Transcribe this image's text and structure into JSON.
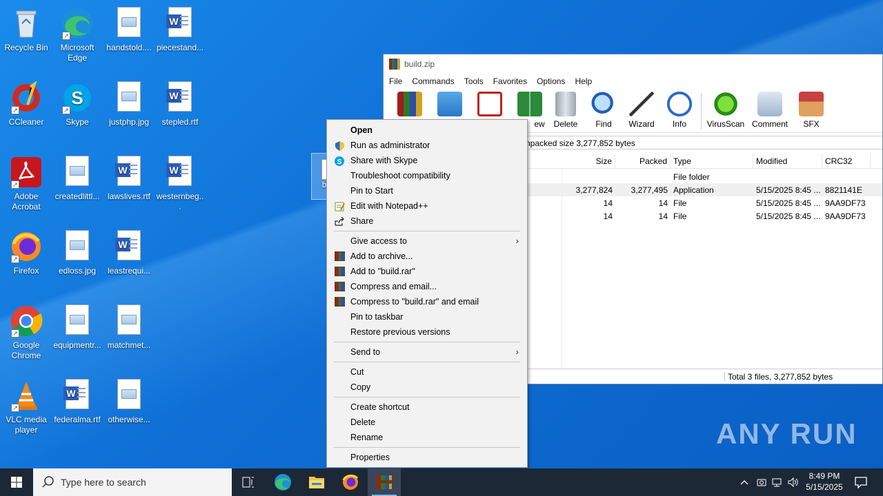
{
  "desktop": {
    "icons": [
      {
        "label": "Recycle Bin"
      },
      {
        "label": "Microsoft Edge"
      },
      {
        "label": "handstold...."
      },
      {
        "label": "piecestand..."
      },
      {
        "label": "CCleaner"
      },
      {
        "label": "Skype"
      },
      {
        "label": "justphp.jpg"
      },
      {
        "label": "stepled.rtf"
      },
      {
        "label": "Adobe Acrobat"
      },
      {
        "label": "createdlittl..."
      },
      {
        "label": "lawslives.rtf"
      },
      {
        "label": "westernbeg..."
      },
      {
        "label": "Firefox"
      },
      {
        "label": "edloss.jpg"
      },
      {
        "label": "leastrequi..."
      },
      {
        "label": "Google Chrome"
      },
      {
        "label": "equipmentr..."
      },
      {
        "label": "matchmet..."
      },
      {
        "label": "VLC media player"
      },
      {
        "label": "federalma.rtf"
      },
      {
        "label": "otherwise..."
      }
    ],
    "partial_icon_label": "bu",
    "watermark": "ANY RUN"
  },
  "winrar": {
    "title": "build.zip",
    "menu": [
      "File",
      "Commands",
      "Tools",
      "Favorites",
      "Options",
      "Help"
    ],
    "toolbar": [
      "ew",
      "Delete",
      "Find",
      "Wizard",
      "Info",
      "VirusScan",
      "Comment",
      "SFX"
    ],
    "address": "npacked size 3,277,852 bytes",
    "columns": [
      "Size",
      "Packed",
      "Type",
      "Modified",
      "CRC32"
    ],
    "rows": [
      {
        "size": "",
        "packed": "",
        "type": "File folder",
        "modified": "",
        "crc": ""
      },
      {
        "size": "3,277,824",
        "packed": "3,277,495",
        "type": "Application",
        "modified": "5/15/2025 8:45 ...",
        "crc": "8821141E"
      },
      {
        "size": "14",
        "packed": "14",
        "type": "File",
        "modified": "5/15/2025 8:45 ...",
        "crc": "9AA9DF73"
      },
      {
        "size": "14",
        "packed": "14",
        "type": "File",
        "modified": "5/15/2025 8:45 ...",
        "crc": "9AA9DF73"
      }
    ],
    "status": "Total 3 files, 3,277,852 bytes"
  },
  "context_menu": {
    "open": "Open",
    "run_admin": "Run as administrator",
    "share_skype": "Share with Skype",
    "troubleshoot": "Troubleshoot compatibility",
    "pin_start": "Pin to Start",
    "edit_notepad": "Edit with Notepad++",
    "share": "Share",
    "give_access": "Give access to",
    "add_archive": "Add to archive...",
    "add_build_rar": "Add to \"build.rar\"",
    "compress_email": "Compress and email...",
    "compress_build_email": "Compress to \"build.rar\" and email",
    "pin_taskbar": "Pin to taskbar",
    "restore_versions": "Restore previous versions",
    "send_to": "Send to",
    "cut": "Cut",
    "copy": "Copy",
    "create_shortcut": "Create shortcut",
    "delete": "Delete",
    "rename": "Rename",
    "properties": "Properties"
  },
  "taskbar": {
    "search_placeholder": "Type here to search",
    "time": "8:49 PM",
    "date": "5/15/2025"
  }
}
